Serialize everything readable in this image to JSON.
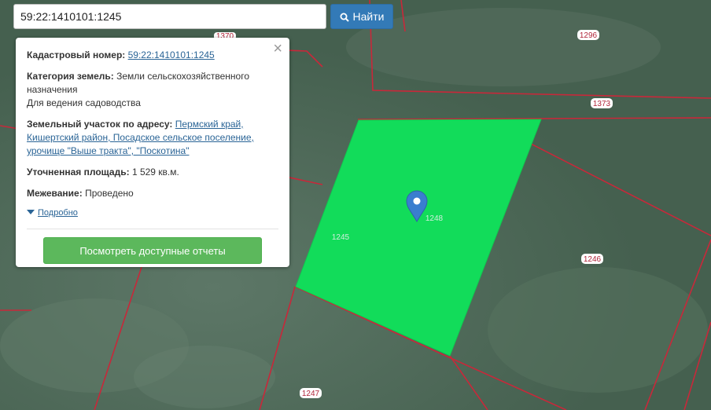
{
  "search": {
    "value": "59:22:1410101:1245",
    "button_label": "Найти"
  },
  "popup": {
    "cadastral_label": "Кадастровый номер:",
    "cadastral_value": "59:22:1410101:1245",
    "category_label": "Категория земель:",
    "category_value": "Земли сельскохозяйственного назначения",
    "use_value": "Для ведения садоводства",
    "address_label": "Земельный участок по адресу:",
    "address_value": "Пермский край, Кишертский район, Посадское сельское поселение, урочище \"Выше тракта\", \"Поскотина\"",
    "area_label": "Уточненная площадь:",
    "area_value": "1 529 кв.м.",
    "survey_label": "Межевание:",
    "survey_value": "Проведено",
    "more_label": "Подробно",
    "reports_button": "Посмотреть доступные отчеты",
    "close_symbol": "×"
  },
  "map": {
    "parcel_labels": {
      "p1296": "1296",
      "p1373": "1373",
      "p1246": "1246",
      "p1247": "1247",
      "p1245": "1245",
      "p1248": "1248",
      "p1370": "1370"
    },
    "colors": {
      "boundary": "#c8283a",
      "selected": "#12dc5a",
      "marker": "#3a7ecf"
    }
  }
}
